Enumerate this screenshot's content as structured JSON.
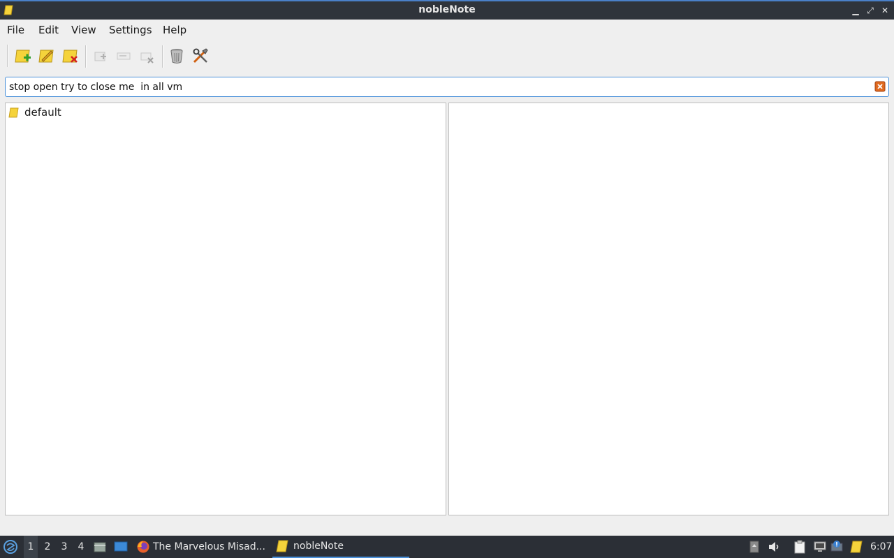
{
  "window": {
    "title": "nobleNote"
  },
  "menu": [
    "File",
    "Edit",
    "View",
    "Settings",
    "Help"
  ],
  "search": {
    "value": "stop open try to close me  in all vm"
  },
  "folders": [
    {
      "label": "default"
    }
  ],
  "taskbar": {
    "workspaces": [
      "1",
      "2",
      "3",
      "4"
    ],
    "active_workspace": "1",
    "tasks": [
      {
        "label": "The Marvelous Misad..."
      },
      {
        "label": "nobleNote"
      }
    ],
    "clock": "6:07"
  },
  "icons": {
    "toolbar": [
      "new-folder-icon",
      "rename-folder-icon",
      "delete-folder-icon",
      "new-note-icon",
      "rename-note-icon",
      "delete-note-icon",
      "trash-icon",
      "settings-icon"
    ]
  },
  "colors": {
    "accent": "#4a90d9",
    "titlebar": "#2f343b",
    "taskbar": "#2b2f36",
    "note_yellow": "#f5d33b"
  }
}
